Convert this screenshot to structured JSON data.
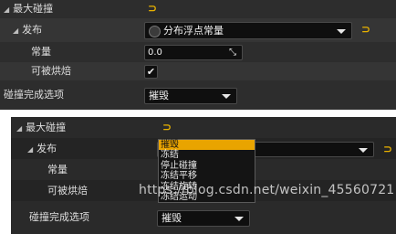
{
  "top_panel": {
    "rows": [
      {
        "label": "最大碰撞"
      },
      {
        "label": "发布",
        "dropdown_value": "分布浮点常量"
      },
      {
        "label": "常量",
        "input_value": "0.0"
      },
      {
        "label": "可被烘焙",
        "checked": true
      },
      {
        "label": "碰撞完成选项",
        "dropdown_value": "摧毁"
      }
    ]
  },
  "bottom_panel": {
    "rows": [
      {
        "label": "最大碰撞"
      },
      {
        "label": "发布"
      },
      {
        "label": "常量"
      },
      {
        "label": "可被烘焙"
      },
      {
        "label": "碰撞完成选项",
        "dropdown_value": "摧毁"
      }
    ],
    "menu_options": [
      "摧毁",
      "冻结",
      "停止碰撞",
      "冻结平移",
      "冻结旋转",
      "冻结运动"
    ],
    "selected_option": "摧毁"
  },
  "watermark": "https://blog.csdn.net/weixin_45560721",
  "icons": {
    "reset": "reset-arrow-icon",
    "expand": "expand-triangle-icon",
    "dropdown": "chevron-down-icon",
    "check": "checkmark-icon",
    "drag": "drag-resize-icon",
    "radio": "radio-icon"
  },
  "colors": {
    "panel_bg": "#242424",
    "reset_icon": "#e8b100",
    "menu_selected": "#e9a400"
  }
}
